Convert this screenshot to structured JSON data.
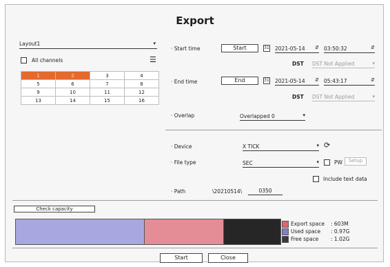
{
  "dialog": {
    "title": "Export"
  },
  "layout": {
    "selected": "Layout1",
    "all_channels_label": "All channels"
  },
  "channels": [
    {
      "label": "1",
      "selected": true
    },
    {
      "label": "2",
      "selected": true
    },
    {
      "label": "3",
      "selected": false
    },
    {
      "label": "4",
      "selected": false
    },
    {
      "label": "5",
      "selected": false
    },
    {
      "label": "6",
      "selected": false
    },
    {
      "label": "7",
      "selected": false
    },
    {
      "label": "8",
      "selected": false
    },
    {
      "label": "9",
      "selected": false
    },
    {
      "label": "10",
      "selected": false
    },
    {
      "label": "11",
      "selected": false
    },
    {
      "label": "12",
      "selected": false
    },
    {
      "label": "13",
      "selected": false
    },
    {
      "label": "14",
      "selected": false
    },
    {
      "label": "15",
      "selected": false
    },
    {
      "label": "16",
      "selected": false
    }
  ],
  "start_time": {
    "label": "Start time",
    "button": "Start",
    "date": "2021-05-14",
    "time": "03:50:32",
    "dst_label": "DST",
    "dst_value": "DST Not Applied"
  },
  "end_time": {
    "label": "End time",
    "button": "End",
    "date": "2021-05-14",
    "time": "05:43:17",
    "dst_label": "DST",
    "dst_value": "DST Not Applied"
  },
  "overlap": {
    "label": "Overlap",
    "value": "Overlapped 0"
  },
  "device": {
    "label": "Device",
    "value": "X TICK"
  },
  "file_type": {
    "label": "File type",
    "value": "SEC",
    "pw_label": "PW",
    "setup_label": "Setup",
    "include_text_label": "Include text data"
  },
  "path": {
    "label": "Path",
    "folder": "\\20210514\\",
    "name": "0350"
  },
  "capacity": {
    "check_label": "Check capacity",
    "legend": [
      {
        "label": "Export space",
        "value": ": 603M",
        "color": "#e06474"
      },
      {
        "label": "Used space",
        "value": ": 0.97G",
        "color": "#8080cc"
      },
      {
        "label": "Free space",
        "value": ": 1.02G",
        "color": "#3a3a3a"
      }
    ],
    "bar_colors": {
      "used": "#a8a8e0",
      "export": "#e58d96",
      "free": "#262626"
    }
  },
  "footer": {
    "start_label": "Start",
    "close_label": "Close"
  }
}
